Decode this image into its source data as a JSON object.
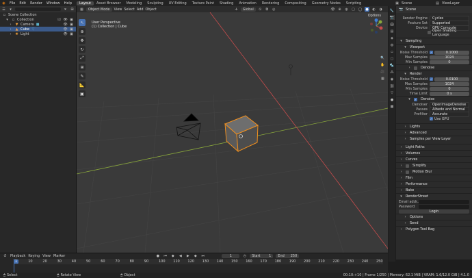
{
  "topbar": {
    "menus": [
      "File",
      "Edit",
      "Render",
      "Window",
      "Help"
    ],
    "workspaces": [
      "Layout",
      "Asset Browser",
      "Modeling",
      "Sculpting",
      "UV Editing",
      "Texture Paint",
      "Shading",
      "Animation",
      "Rendering",
      "Compositing",
      "Geometry Nodes",
      "Scripting"
    ],
    "active_workspace": "Layout",
    "scene": "Scene",
    "view_layer": "ViewLayer"
  },
  "outliner": {
    "items": [
      {
        "label": "Scene Collection",
        "level": 0,
        "selected": false
      },
      {
        "label": "Collection",
        "level": 1,
        "selected": false
      },
      {
        "label": "Camera",
        "level": 2,
        "selected": false
      },
      {
        "label": "Cube",
        "level": 2,
        "selected": true
      },
      {
        "label": "Light",
        "level": 2,
        "selected": false
      }
    ]
  },
  "viewport": {
    "header": {
      "mode": "Object Mode",
      "menus": [
        "View",
        "Select",
        "Add",
        "Object"
      ],
      "transform": "Global",
      "options_label": "Options"
    },
    "info_line1": "User Perspective",
    "info_line2": "(1) Collection | Cube"
  },
  "properties": {
    "title": "Scene",
    "render_engine_label": "Render Engine",
    "render_engine": "Cycles",
    "feature_set_label": "Feature Set",
    "feature_set": "Supported",
    "device_label": "Device",
    "device": "GPU Compute",
    "osl_label": "Open Shading Language",
    "sampling": "Sampling",
    "viewport": "Viewport",
    "vp_noise_label": "Noise Threshold",
    "vp_noise": "0.1000",
    "vp_max_label": "Max Samples",
    "vp_max": "1024",
    "vp_min_label": "Min Samples",
    "vp_min": "0",
    "vp_denoise": "Denoise",
    "render": "Render",
    "r_noise_label": "Noise Threshold",
    "r_noise": "0.0100",
    "r_max_label": "Max Samples",
    "r_max": "1024",
    "r_min_label": "Min Samples",
    "r_min": "0",
    "r_time_label": "Time Limit",
    "r_time": "0 s",
    "denoise": "Denoise",
    "denoiser_label": "Denoiser",
    "denoiser": "OpenImageDenoise",
    "passes_label": "Passes",
    "passes": "Albedo and Normal",
    "prefilter_label": "Prefilter",
    "prefilter": "Accurate",
    "use_gpu": "Use GPU",
    "lights": "Lights",
    "advanced": "Advanced",
    "samples_per_view_layer": "Samples per View Layer",
    "light_paths": "Light Paths",
    "volumes": "Volumes",
    "curves": "Curves",
    "simplify": "Simplify",
    "motion_blur": "Motion Blur",
    "film": "Film",
    "performance": "Performance",
    "bake": "Bake",
    "renderstreet": "RenderStreet",
    "email_label": "Email addr...",
    "password_label": "Password",
    "login": "Login",
    "options": "Options",
    "send": "Send",
    "polygon_tool_bag": "Polygon Tool Bag"
  },
  "timeline": {
    "menus": [
      "Playback",
      "Keying",
      "View",
      "Marker"
    ],
    "current_frame": "1",
    "start_label": "Start",
    "start": "1",
    "end_label": "End",
    "end": "250",
    "ticks": [
      "1",
      "10",
      "20",
      "30",
      "40",
      "50",
      "60",
      "70",
      "80",
      "90",
      "100",
      "110",
      "120",
      "130",
      "140",
      "150",
      "160",
      "170",
      "180",
      "190",
      "200",
      "210",
      "220",
      "230",
      "240",
      "250"
    ]
  },
  "statusbar": {
    "select": "Select",
    "rotate_view": "Rotate View",
    "object": "Object",
    "stats": "00:10:+10 | Frame 1/250 | Memory: 62.1 MiB | VRAM: 1.6/12.0 GiB | 4.1.0"
  },
  "colors": {
    "accent": "#4772b3",
    "selection_outline": "#f08f1e",
    "x_axis": "#c84c4c",
    "y_axis": "#8aa83c"
  }
}
